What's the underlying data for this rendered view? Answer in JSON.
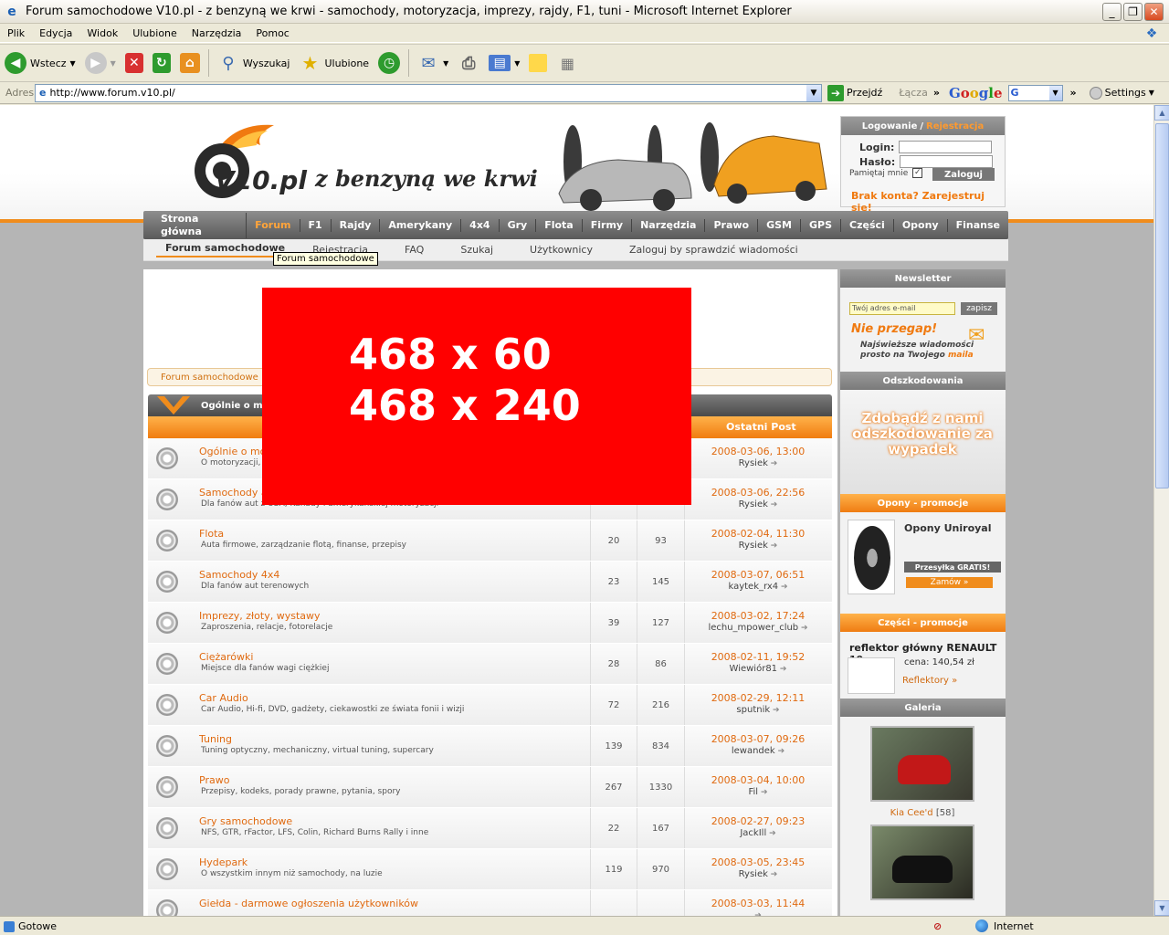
{
  "window": {
    "title": "Forum samochodowe V10.pl - z benzyną we krwi - samochody, motoryzacja, imprezy, rajdy, F1, tuni - Microsoft Internet Explorer"
  },
  "menu": [
    "Plik",
    "Edycja",
    "Widok",
    "Ulubione",
    "Narzędzia",
    "Pomoc"
  ],
  "toolbar": {
    "back": "Wstecz",
    "search": "Wyszukaj",
    "favorites": "Ulubione"
  },
  "address": {
    "label": "Adres",
    "url": "http://www.forum.v10.pl/",
    "go": "Przejdź",
    "links": "Łącza",
    "settings": "Settings"
  },
  "status": {
    "text": "Gotowe",
    "zone": "Internet"
  },
  "site": {
    "slogan": "z benzyną we krwi",
    "logo_text": "V10.pl",
    "login": {
      "header": "Logowanie",
      "sep": "/",
      "register": "Rejestracja",
      "login_label": "Login:",
      "pass_label": "Hasło:",
      "remember": "Pamiętaj mnie",
      "button": "Zaloguj",
      "no_account": "Brak konta? Zarejestruj się!"
    },
    "nav": [
      "Strona główna",
      "Forum",
      "F1",
      "Rajdy",
      "Amerykany",
      "4x4",
      "Gry",
      "Flota",
      "Firmy",
      "Narzędzia",
      "Prawo",
      "GSM",
      "GPS",
      "Części",
      "Opony",
      "Finanse"
    ],
    "nav_active": "Forum",
    "subnav": [
      "Forum samochodowe",
      "Rejestracja",
      "FAQ",
      "Szukaj",
      "Użytkownicy",
      "Zaloguj by sprawdzić wiadomości"
    ],
    "tooltip": "Forum samochodowe",
    "breadcrumb": "Forum samochodowe",
    "category": "Ogólnie o moto",
    "col_last": "Ostatni Post",
    "ad": {
      "line1": "468 x 60",
      "line2": "468 x 240"
    },
    "forums": [
      {
        "name": "Ogólnie o moto",
        "desc": "O motoryzacji,",
        "topics": "",
        "posts": "",
        "date": "2008-03-06, 13:00",
        "user": "Rysiek"
      },
      {
        "name": "Samochody ar",
        "desc": "Dla fanów aut z USA, Kanady i amerykańskiej motoryzacji",
        "topics": "",
        "posts": "",
        "date": "2008-03-06, 22:56",
        "user": "Rysiek"
      },
      {
        "name": "Flota",
        "desc": "Auta firmowe, zarządzanie flotą, finanse, przepisy",
        "topics": "20",
        "posts": "93",
        "date": "2008-02-04, 11:30",
        "user": "Rysiek"
      },
      {
        "name": "Samochody 4x4",
        "desc": "Dla fanów aut terenowych",
        "topics": "23",
        "posts": "145",
        "date": "2008-03-07, 06:51",
        "user": "kaytek_rx4"
      },
      {
        "name": "Imprezy, złoty, wystawy",
        "desc": "Zaproszenia, relacje, fotorelacje",
        "topics": "39",
        "posts": "127",
        "date": "2008-03-02, 17:24",
        "user": "lechu_mpower_club"
      },
      {
        "name": "Ciężarówki",
        "desc": "Miejsce dla fanów wagi ciężkiej",
        "topics": "28",
        "posts": "86",
        "date": "2008-02-11, 19:52",
        "user": "Wiewiór81"
      },
      {
        "name": "Car Audio",
        "desc": "Car Audio, Hi-fi, DVD, gadżety, ciekawostki ze świata fonii i wizji",
        "topics": "72",
        "posts": "216",
        "date": "2008-02-29, 12:11",
        "user": "sputnik"
      },
      {
        "name": "Tuning",
        "desc": "Tuning optyczny, mechaniczny, virtual tuning, supercary",
        "topics": "139",
        "posts": "834",
        "date": "2008-03-07, 09:26",
        "user": "lewandek"
      },
      {
        "name": "Prawo",
        "desc": "Przepisy, kodeks, porady prawne, pytania, spory",
        "topics": "267",
        "posts": "1330",
        "date": "2008-03-04, 10:00",
        "user": "Fil"
      },
      {
        "name": "Gry samochodowe",
        "desc": "NFS, GTR, rFactor, LFS, Colin, Richard Burns Rally i inne",
        "topics": "22",
        "posts": "167",
        "date": "2008-02-27, 09:23",
        "user": "JackIll"
      },
      {
        "name": "Hydepark",
        "desc": "O wszystkim innym niż samochody, na luzie",
        "topics": "119",
        "posts": "970",
        "date": "2008-03-05, 23:45",
        "user": "Rysiek"
      },
      {
        "name": "Giełda - darmowe ogłoszenia użytkowników",
        "desc": "",
        "topics": "",
        "posts": "",
        "date": "2008-03-03, 11:44",
        "user": ""
      }
    ],
    "sidebar": {
      "newsletter": "Newsletter",
      "email_placeholder": "Twój adres e-mail",
      "subscribe": "zapisz",
      "nie_przegap": "Nie przegap!",
      "nl_line1": "Najświeższe wiadomości",
      "nl_line2": "prosto na Twojego",
      "nl_mail": "maila",
      "odszk": "Odszkodowania",
      "odszk_promo": "Zdobądź z nami odszkodowanie za wypadek",
      "opony_hdr": "Opony - promocje",
      "opony_title": "Opony Uniroyal",
      "przesylka": "Przesyłka GRATIS!",
      "zamow": "Zamów »",
      "czesci_hdr": "Części - promocje",
      "czesci_title": "reflektor główny RENAULT 19",
      "cena": "cena: 140,54 zł",
      "reflektory": "Reflektory »",
      "galeria": "Galeria",
      "gal_caption": "Kia Cee'd",
      "gal_count": "[58]"
    }
  }
}
